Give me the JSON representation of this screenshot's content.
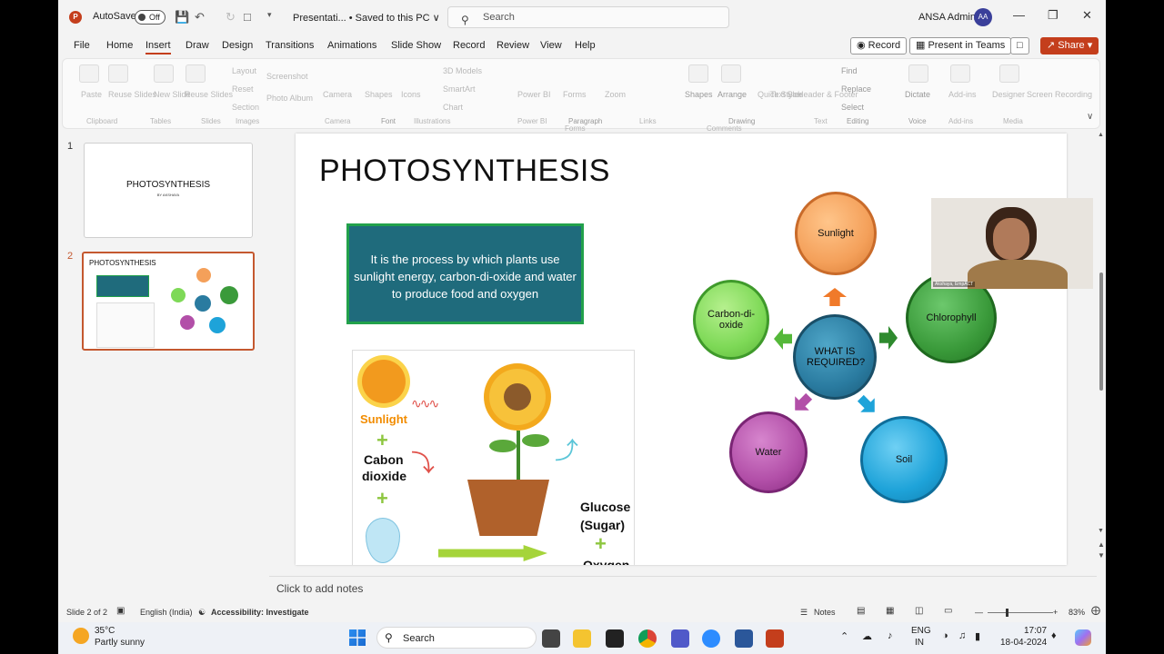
{
  "window": {
    "autosave_label": "AutoSave",
    "autosave_state": "Off",
    "doc_title": "Presentati... • Saved to this PC ∨",
    "search_placeholder": "Search",
    "user_name": "ANSA Admin",
    "user_initials": "AA"
  },
  "menu": {
    "tabs": [
      "File",
      "Home",
      "Insert",
      "Draw",
      "Design",
      "Transitions",
      "Animations",
      "Slide Show",
      "Record",
      "Review",
      "View",
      "Help"
    ],
    "active": "Insert",
    "record_btn": "Record",
    "teams_btn": "Present in Teams",
    "share_btn": "Share"
  },
  "ribbon": {
    "items": [
      "Paste",
      "Reuse Slides",
      "New Slide",
      "Reuse Slides",
      "Layout",
      "Reset",
      "Section",
      "Screenshot",
      "Photo Album",
      "Camera",
      "Shapes",
      "Icons",
      "3D Models",
      "SmartArt",
      "Chart",
      "Power BI",
      "Forms",
      "Zoom",
      "Shapes",
      "Arrange",
      "Quick Styles",
      "Text Box",
      "Header & Footer",
      "Find",
      "Replace",
      "Select",
      "Dictate",
      "Add-ins",
      "Designer",
      "Screen Recording"
    ],
    "groups": [
      "Clipboard",
      "Tables",
      "Slides",
      "Images",
      "Camera",
      "Font",
      "Illustrations",
      "Power BI",
      "Paragraph",
      "Forms",
      "Links",
      "Drawing",
      "Comments",
      "Text",
      "Editing",
      "Voice",
      "Add-ins",
      "Media"
    ]
  },
  "thumbnails": [
    {
      "num": "1",
      "title": "PHOTOSYNTHESIS",
      "subtitle": "BY AKSHAYA"
    },
    {
      "num": "2",
      "title": "PHOTOSYNTHESIS"
    }
  ],
  "slide": {
    "title": "PHOTOSYNTHESIS",
    "definition": "It is the process by which plants use sunlight energy, carbon-di-oxide and water to produce food and oxygen",
    "illustration": {
      "sunlight": "Sunlight",
      "cabon": "Cabon",
      "dioxide": "dioxide",
      "glucose": "Glucose",
      "sugar": "(Sugar)",
      "oxygen": "Oxygen"
    },
    "diagram": {
      "center": "WHAT IS REQUIRED?",
      "sunlight": "Sunlight",
      "chlorophyll": "Chlorophyll",
      "soil": "Soil",
      "water": "Water",
      "carbon": "Carbon-di-oxide",
      "colors": {
        "sunlight": "#f4a05a",
        "chlorophyll": "#3a9a3a",
        "soil": "#1ea3d9",
        "water": "#b24fa8",
        "carbon": "#7ed957",
        "center": "#2a7ba0"
      }
    },
    "webcam_label": "Akshaya, EmpACT"
  },
  "notes_placeholder": "Click to add notes",
  "status": {
    "slide": "Slide 2 of 2",
    "language": "English (India)",
    "accessibility": "Accessibility: Investigate",
    "notes": "Notes",
    "zoom": "83%"
  },
  "taskbar": {
    "temp": "35°C",
    "weather": "Partly sunny",
    "search": "Search",
    "lang1": "ENG",
    "lang2": "IN",
    "time": "17:07",
    "date": "18-04-2024"
  }
}
